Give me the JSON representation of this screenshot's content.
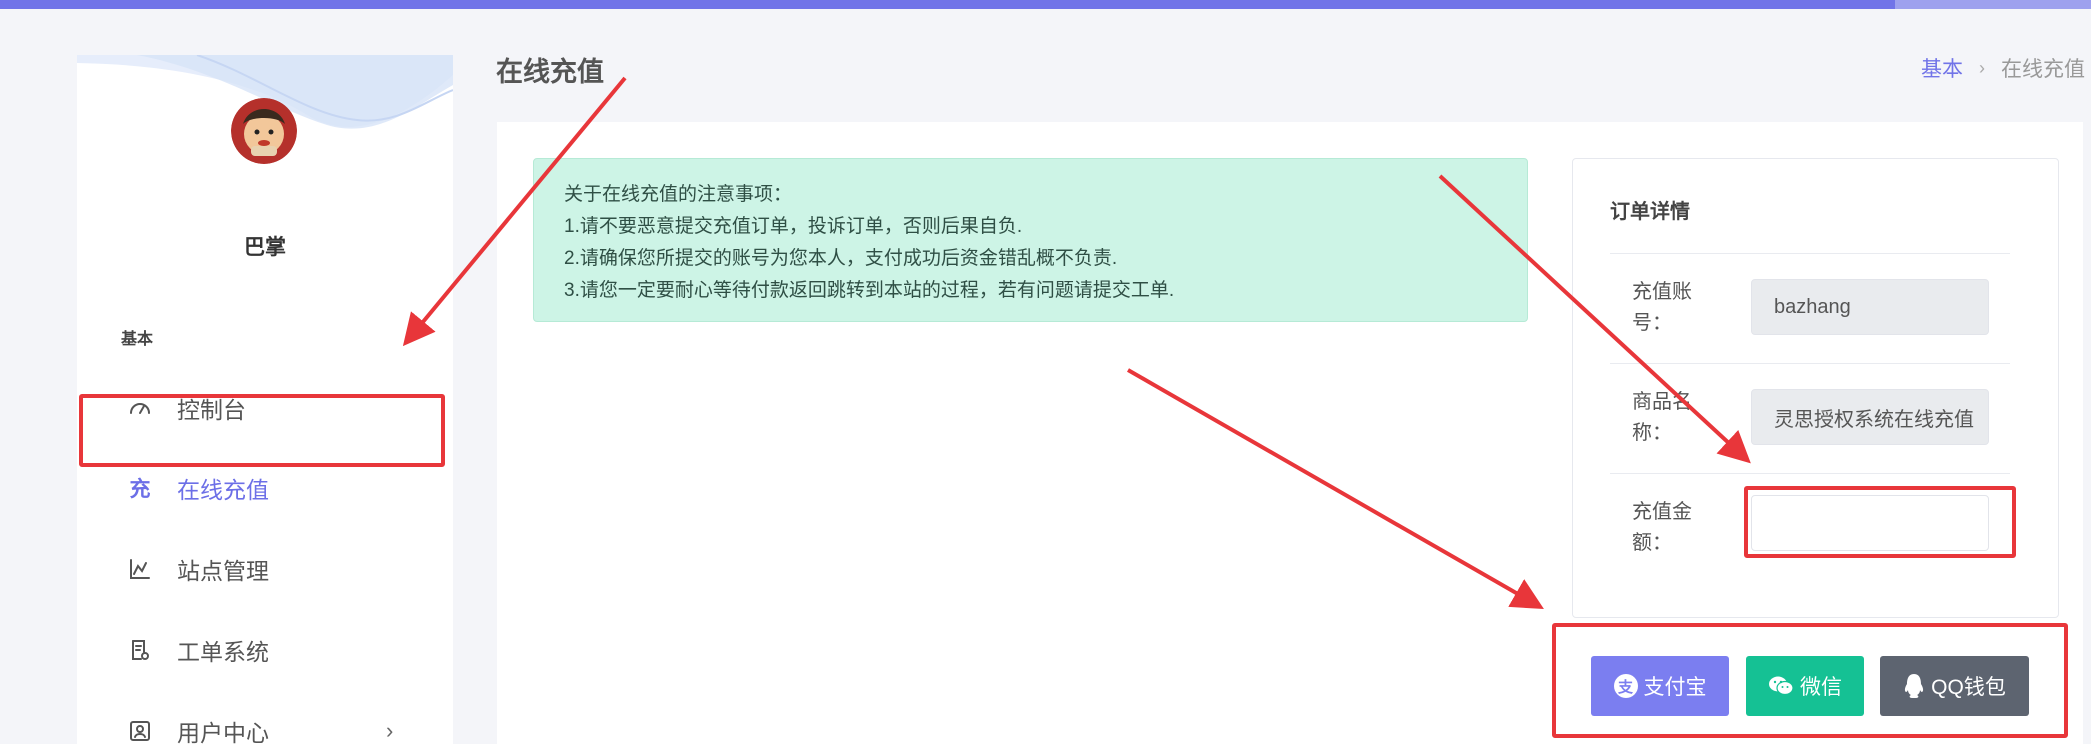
{
  "colors": {
    "accent": "#7174e8",
    "notice_bg": "#cdf4e6",
    "alipay": "#7b7ef0",
    "wechat": "#15c194",
    "qq": "#5d6470",
    "annotation": "#e8363a"
  },
  "sidebar": {
    "username": "巴掌",
    "section": "基本",
    "items": [
      {
        "label": "控制台",
        "icon": "gauge-icon"
      },
      {
        "label": "在线充值",
        "icon": "recharge-icon",
        "active": true,
        "icon_text": "充"
      },
      {
        "label": "站点管理",
        "icon": "chart-icon"
      },
      {
        "label": "工单系统",
        "icon": "ticket-icon"
      },
      {
        "label": "用户中心",
        "icon": "user-card-icon",
        "arrow": "›"
      }
    ]
  },
  "header": {
    "title": "在线充值",
    "breadcrumb": {
      "home": "基本",
      "separator": "›",
      "current": "在线充值"
    }
  },
  "notice": {
    "lines": [
      "关于在线充值的注意事项：",
      "1.请不要恶意提交充值订单，投诉订单，否则后果自负.",
      "2.请确保您所提交的账号为您本人，支付成功后资金错乱概不负责.",
      "3.请您一定要耐心等待付款返回跳转到本站的过程，若有问题请提交工单."
    ]
  },
  "order": {
    "title": "订单详情",
    "account_label_1": "充值账",
    "account_label_2": "号：",
    "account_value": "bazhang",
    "product_label_1": "商品名",
    "product_label_2": "称：",
    "product_value": "灵思授权系统在线充值",
    "amount_label_1": "充值金",
    "amount_label_2": "额：",
    "amount_value": ""
  },
  "payment": {
    "alipay": "支付宝",
    "alipay_icon_char": "支",
    "wechat": "微信",
    "qq": "QQ钱包"
  }
}
